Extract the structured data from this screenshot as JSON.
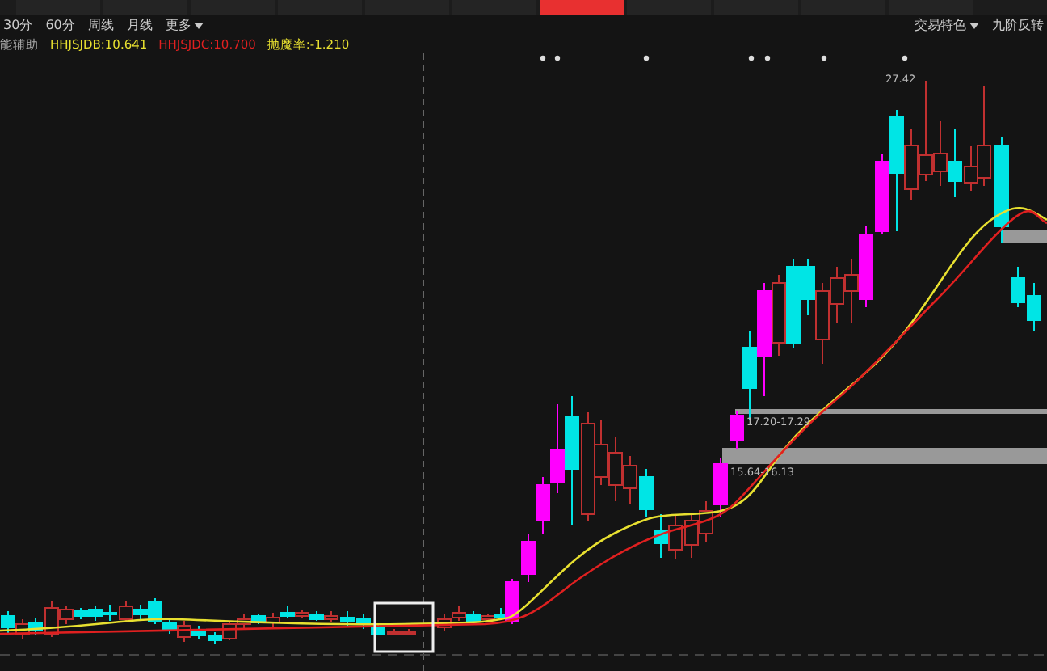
{
  "top_tabs": [
    {
      "selected": false
    },
    {
      "selected": false
    },
    {
      "selected": false
    },
    {
      "selected": false
    },
    {
      "selected": false
    },
    {
      "selected": false
    },
    {
      "selected": true
    },
    {
      "selected": false
    },
    {
      "selected": false
    },
    {
      "selected": false
    },
    {
      "selected": false
    }
  ],
  "periods": [
    {
      "label": "30分"
    },
    {
      "label": "60分"
    },
    {
      "label": "周线"
    },
    {
      "label": "月线"
    }
  ],
  "more": "更多",
  "right_menu": "交易特色",
  "right_label": "九阶反转",
  "indicator": {
    "name": "能辅助",
    "values": [
      {
        "label": "HHJSJDB:10.641",
        "color": "#e8e030"
      },
      {
        "label": "HHJSJDC:10.700",
        "color": "#e02020"
      },
      {
        "label": "抛魔率:-1.210",
        "color": "#e8e030"
      }
    ]
  },
  "chart": {
    "high_label": "27.42",
    "zones": [
      {
        "label": "17.20-17.29"
      },
      {
        "label": "15.64-16.13"
      }
    ]
  }
}
